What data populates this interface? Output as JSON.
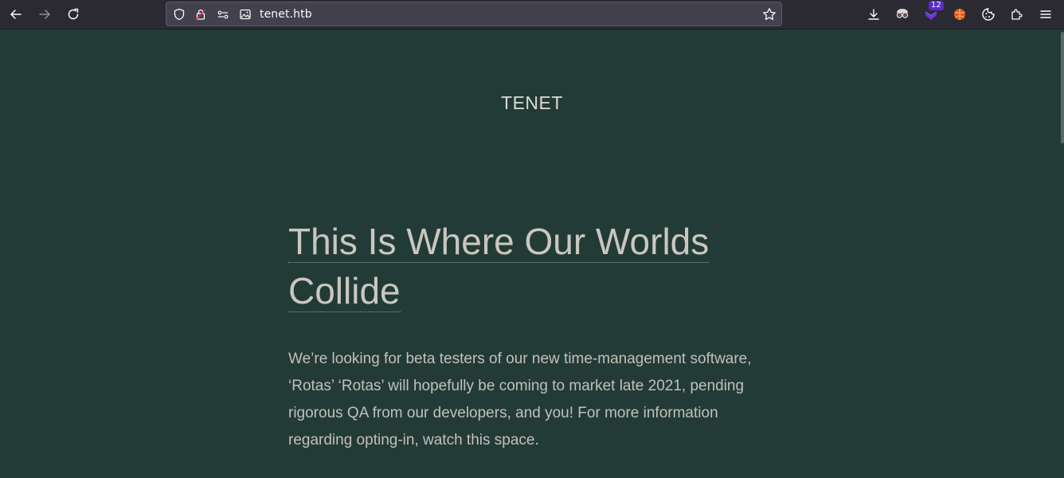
{
  "browser": {
    "url": "tenet.htb",
    "extension_badge": "12"
  },
  "site": {
    "name": "TENET"
  },
  "post": {
    "title": "This Is Where Our Worlds Collide",
    "body": "We’re looking for beta testers of our new time-management software, ‘Rotas’ ‘Rotas’ will hopefully be coming to market late 2021, pending rigorous QA from our developers, and you! For more information regarding opting-in, watch this space."
  },
  "colors": {
    "page_background": "#233b36",
    "toolbar_background": "#2b2a33",
    "text": "#c2c0b9",
    "badge": "#592acb"
  },
  "icons": [
    "back-icon",
    "forward-icon",
    "reload-icon",
    "shield-icon",
    "lock-icon",
    "permissions-icon",
    "image-icon",
    "bookmark-star-icon",
    "download-icon",
    "extension-spy-icon",
    "extension-shield-icon",
    "extension-ball-icon",
    "cookie-icon",
    "puzzle-icon",
    "menu-icon"
  ]
}
